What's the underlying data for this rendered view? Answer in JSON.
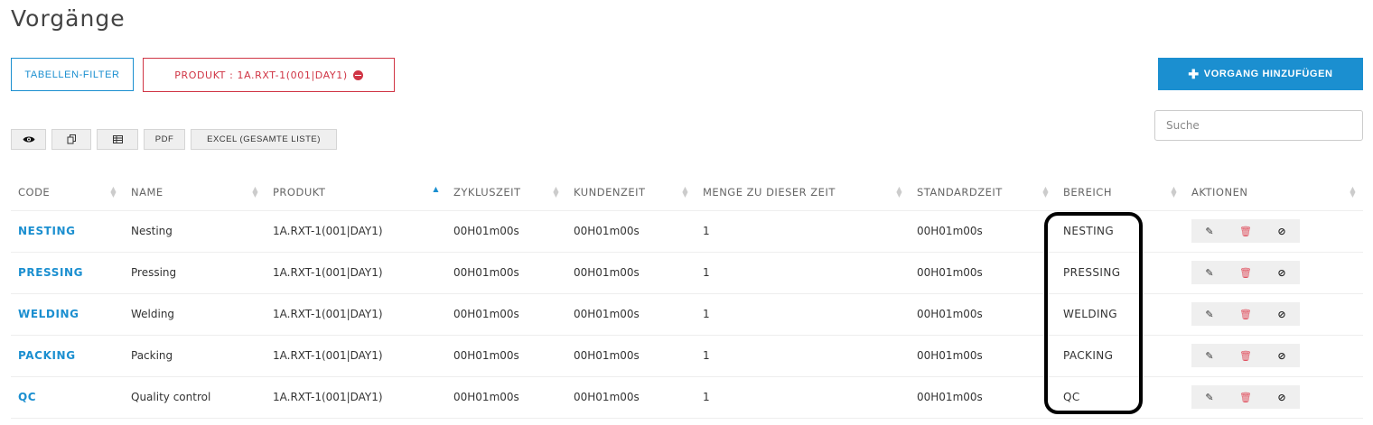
{
  "page": {
    "title": "Vorgänge"
  },
  "filters": {
    "table_filter_label": "TABELLEN-FILTER",
    "product_chip_label": "PRODUKT : 1A.RXT-1(001|DAY1)"
  },
  "actions": {
    "add_label": "VORGANG HINZUFÜGEN"
  },
  "toolbar": {
    "pdf_label": "PDF",
    "excel_label": "EXCEL (GESAMTE LISTE)"
  },
  "search": {
    "placeholder": "Suche",
    "value": ""
  },
  "table": {
    "columns": [
      "CODE",
      "NAME",
      "PRODUKT",
      "ZYKLUSZEIT",
      "KUNDENZEIT",
      "MENGE ZU DIESER ZEIT",
      "STANDARDZEIT",
      "BEREICH",
      "AKTIONEN"
    ],
    "rows": [
      {
        "code": "NESTING",
        "name": "Nesting",
        "produkt": "1A.RXT-1(001|DAY1)",
        "zykluszeit": "00H01m00s",
        "kundenzeit": "00H01m00s",
        "menge": "1",
        "standardzeit": "00H01m00s",
        "bereich": "NESTING"
      },
      {
        "code": "PRESSING",
        "name": "Pressing",
        "produkt": "1A.RXT-1(001|DAY1)",
        "zykluszeit": "00H01m00s",
        "kundenzeit": "00H01m00s",
        "menge": "1",
        "standardzeit": "00H01m00s",
        "bereich": "PRESSING"
      },
      {
        "code": "WELDING",
        "name": "Welding",
        "produkt": "1A.RXT-1(001|DAY1)",
        "zykluszeit": "00H01m00s",
        "kundenzeit": "00H01m00s",
        "menge": "1",
        "standardzeit": "00H01m00s",
        "bereich": "WELDING"
      },
      {
        "code": "PACKING",
        "name": "Packing",
        "produkt": "1A.RXT-1(001|DAY1)",
        "zykluszeit": "00H01m00s",
        "kundenzeit": "00H01m00s",
        "menge": "1",
        "standardzeit": "00H01m00s",
        "bereich": "PACKING"
      },
      {
        "code": "QC",
        "name": "Quality control",
        "produkt": "1A.RXT-1(001|DAY1)",
        "zykluszeit": "00H01m00s",
        "kundenzeit": "00H01m00s",
        "menge": "1",
        "standardzeit": "00H01m00s",
        "bereich": "QC"
      }
    ]
  },
  "colors": {
    "accent": "#1b8fd0",
    "danger": "#d03545"
  },
  "icons": [
    "eye-icon",
    "copy-icon",
    "csv-icon",
    "remove-icon",
    "plus-icon",
    "edit-icon",
    "trash-icon",
    "block-icon",
    "sort-icon"
  ]
}
